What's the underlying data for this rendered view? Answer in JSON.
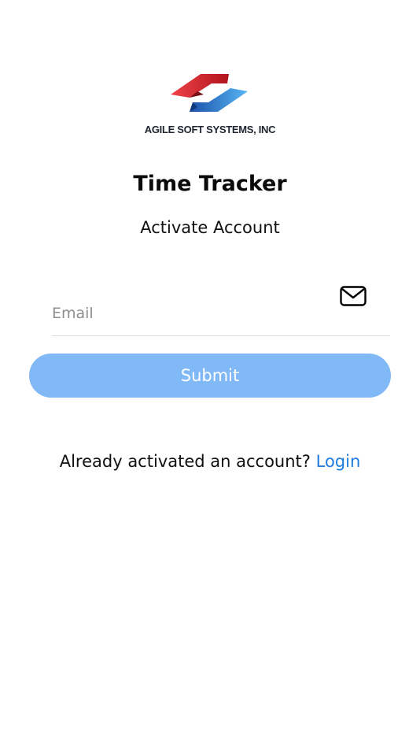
{
  "logo": {
    "company": "AGILE SOFT SYSTEMS, INC"
  },
  "app": {
    "title": "Time Tracker",
    "subtitle": "Activate Account"
  },
  "form": {
    "email_placeholder": "Email",
    "email_value": "",
    "email_icon": "mail-icon",
    "submit_label": "Submit"
  },
  "footer": {
    "prompt": "Already activated an account?",
    "login_label": "Login"
  },
  "colors": {
    "submit_bg": "#80b9f6",
    "link": "#1e7be0",
    "logo_red": "#d8262a",
    "logo_blue": "#2f8fe0"
  }
}
